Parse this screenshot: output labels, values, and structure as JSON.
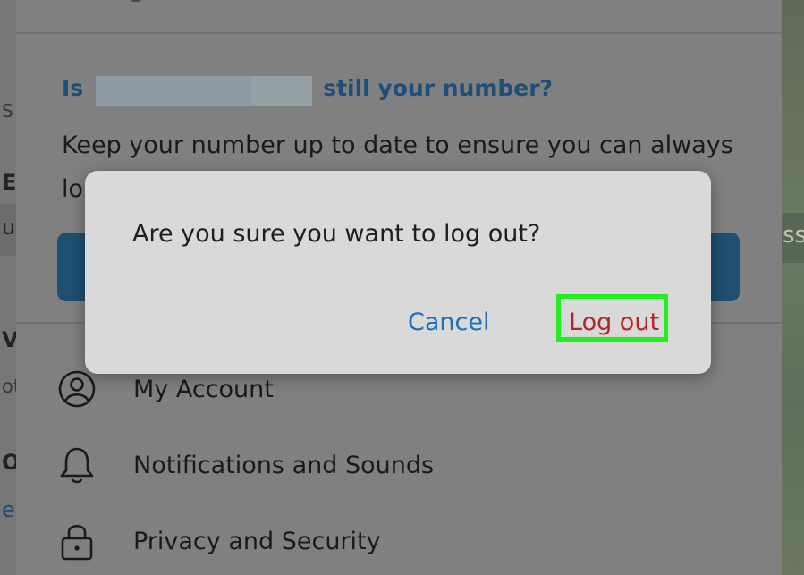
{
  "dialog": {
    "message": "Are you sure you want to log out?",
    "cancel_label": "Cancel",
    "logout_label": "Log out"
  },
  "number_card": {
    "title_prefix": "Is",
    "title_suffix": "still your number?",
    "description_line1": "Keep your number up to date to ensure you can always",
    "description_line2": "lo"
  },
  "menu": {
    "items": [
      {
        "label": "My Account",
        "icon": "account-icon"
      },
      {
        "label": "Notifications and Sounds",
        "icon": "bell-icon"
      },
      {
        "label": "Privacy and Security",
        "icon": "lock-icon"
      }
    ]
  },
  "background": {
    "left_fragments": [
      "S",
      "E",
      "u",
      "V",
      "ot",
      "O",
      "e"
    ],
    "right_fragment": "ssa"
  },
  "colors": {
    "highlight": "#22ee22",
    "logout_red": "#b3242b",
    "cancel_blue": "#1e6fb8"
  }
}
